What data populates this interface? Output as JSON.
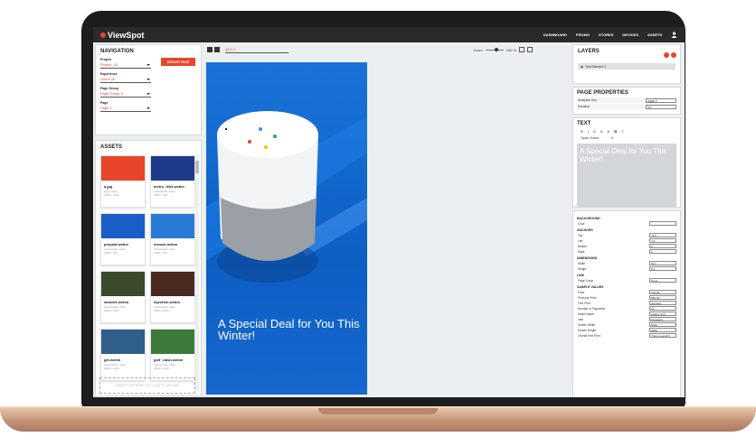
{
  "topbar": {
    "logo": "ViewSpot",
    "nav": [
      "DASHBOARD",
      "PROMO",
      "STORES",
      "DEVICES",
      "ASSETS"
    ]
  },
  "navigation": {
    "title": "NAVIGATION",
    "create_label": "CREATE PAGE",
    "fields": [
      {
        "label": "Project",
        "value": "Project_24"
      },
      {
        "label": "Experience",
        "value": "Home 20"
      },
      {
        "label": "Page Group",
        "value": "Page Group 3"
      },
      {
        "label": "Page",
        "value": "Page 1"
      }
    ]
  },
  "assets": {
    "title": "ASSETS",
    "drop_label": "DROP FILES HERE OR CLICK TO UPLOAD",
    "items": [
      {
        "name": "a.jpg",
        "meta1": "jpeg image",
        "meta2": "1080 x 1728",
        "color": "#e8452a"
      },
      {
        "name": "metro_lillet.webm",
        "meta1": "video/webm video",
        "meta2": "1280 x 720",
        "color": "#1d3b8a"
      },
      {
        "name": "prepaid.webm",
        "meta1": "video/webm video",
        "meta2": "1280 x 720",
        "color": "#1a5fc8"
      },
      {
        "name": "mosaic.webm",
        "meta1": "video/webm video",
        "meta2": "1280 x 720",
        "color": "#2b7ad6"
      },
      {
        "name": "wizards.webm",
        "meta1": "video/webm video",
        "meta2": "2560 x 1440",
        "color": "#3b4a2a"
      },
      {
        "name": "injection.webm",
        "meta1": "video/webm video",
        "meta2": "2560 x 1440",
        "color": "#4a2a1f"
      },
      {
        "name": "gel.webm",
        "meta1": "video/webm video",
        "meta2": "2560 x 1440",
        "color": "#2f5f8a"
      },
      {
        "name": "golf_clash.webm",
        "meta1": "video/webm video",
        "meta2": "2560 x 1440",
        "color": "#3e7a3a"
      }
    ]
  },
  "canvas": {
    "resolution": "16:9 0",
    "zoom_label": "Zoom",
    "zoom_value": "150 %",
    "headline": "A Special Deal for You This Winter!"
  },
  "layers": {
    "title": "LAYERS",
    "layer_name": "Text Element 1"
  },
  "page_properties": {
    "title": "PAGE PROPERTIES",
    "rows": [
      {
        "label": "Analytics Key",
        "value": "page-1"
      },
      {
        "label": "Duration",
        "value": "10"
      }
    ]
  },
  "text_panel": {
    "title": "TEXT",
    "format_buttons": [
      "B",
      "I",
      "U",
      "S",
      "A",
      "⊠",
      "≡"
    ],
    "font": "Open Sans",
    "size": "0",
    "preview": "A Special Deal for You This Winter!"
  },
  "props": {
    "background": {
      "title": "BACKGROUND",
      "label": "Color"
    },
    "anchors": {
      "title": "ANCHORS",
      "rows": [
        {
          "label": "Top",
          "value": "76.6"
        },
        {
          "label": "Left",
          "value": "7.6"
        },
        {
          "label": "Bottom",
          "value": "0"
        },
        {
          "label": "Right",
          "value": "0"
        }
      ]
    },
    "dimensions": {
      "title": "DIMENSIONS",
      "rows": [
        {
          "label": "Width",
          "value": "93.2"
        },
        {
          "label": "Height",
          "value": "8.3"
        }
      ]
    },
    "link": {
      "title": "LINK",
      "label": "Page Group",
      "value": "None"
    },
    "sample": {
      "title": "SAMPLE VALUES",
      "rows": [
        {
          "label": "Price",
          "value": "799.99"
        },
        {
          "label": "Previous Price",
          "value": "899.99"
        },
        {
          "label": "Fine Print",
          "value": "deepika"
        },
        {
          "label": "Number of Payments",
          "value": "12"
        },
        {
          "label": "Model Name",
          "value": "Galaxy S10"
        },
        {
          "label": "oem",
          "value": "Pineapple"
        },
        {
          "label": "Screen Width",
          "value": "6000"
        },
        {
          "label": "Screen Height",
          "value": "2560"
        },
        {
          "label": "Overall Fine Print",
          "value": "This is overall fi"
        }
      ]
    }
  }
}
